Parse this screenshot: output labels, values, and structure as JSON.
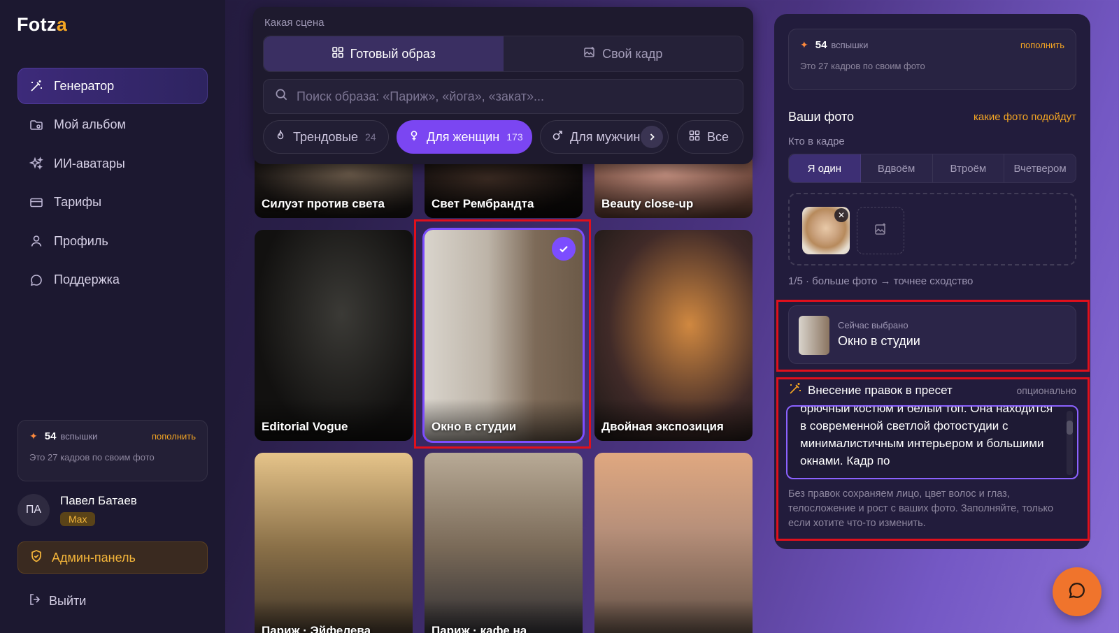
{
  "app": {
    "logo_prefix": "Fotz",
    "logo_accent": "a"
  },
  "sidebar": {
    "items": [
      {
        "label": "Генератор",
        "icon": "magic-wand-icon",
        "active": true
      },
      {
        "label": "Мой альбом",
        "icon": "folder-icon"
      },
      {
        "label": "ИИ-аватары",
        "icon": "sparkles-icon"
      },
      {
        "label": "Тарифы",
        "icon": "credit-card-icon"
      },
      {
        "label": "Профиль",
        "icon": "user-icon"
      },
      {
        "label": "Поддержка",
        "icon": "chat-icon"
      }
    ],
    "credits": {
      "count": "54",
      "unit": "вспышки",
      "topup": "пополнить",
      "sub": "Это 27 кадров по своим фото"
    },
    "user": {
      "initials": "ПА",
      "name": "Павел Батаев",
      "plan": "Max"
    },
    "admin_label": "Админ-панель",
    "logout_label": "Выйти"
  },
  "scene": {
    "label": "Какая сцена",
    "tabs": [
      {
        "label": "Готовый образ",
        "active": true
      },
      {
        "label": "Свой кадр"
      }
    ],
    "search_placeholder": "Поиск образа: «Париж», «йога», «закат»...",
    "chips": [
      {
        "label": "Трендовые",
        "count": "24"
      },
      {
        "label": "Для женщин",
        "count": "173",
        "active": true
      },
      {
        "label": "Для мужчин"
      },
      {
        "label": "Все"
      }
    ]
  },
  "gallery": {
    "tiles": [
      {
        "caption": "Силуэт против света"
      },
      {
        "caption": "Свет Рембрандта"
      },
      {
        "caption": "Beauty close-up"
      },
      {
        "caption": "Editorial Vogue"
      },
      {
        "caption": "Окно в студии",
        "selected": true
      },
      {
        "caption": "Двойная экспозиция"
      },
      {
        "caption": "Париж · Эйфелева"
      },
      {
        "caption": "Париж · кафе на"
      },
      {
        "caption": ""
      }
    ]
  },
  "panel": {
    "credits": {
      "count": "54",
      "unit": "вспышки",
      "topup": "пополнить",
      "sub": "Это 27 кадров по своим фото"
    },
    "photos_title": "Ваши фото",
    "photos_link": "какие фото подойдут",
    "who_label": "Кто в кадре",
    "who_options": [
      "Я один",
      "Вдвоём",
      "Втроём",
      "Вчетвером"
    ],
    "upload_hint": "1/5 · больше фото → точнее сходство",
    "current_label": "Сейчас выбрано",
    "current_value": "Окно в студии",
    "edit_title": "Внесение правок в пресет",
    "edit_optional": "опционально",
    "edit_text": "брючный костюм и белый топ. Она находится в современной светлой фотостудии с минималистичным интерьером и большими окнами. Кадр по",
    "edit_help": "Без правок сохраняем лицо, цвет волос и глаз, телосложение и рост с ваших фото. Заполняйте, только если хотите что-то изменить."
  },
  "colors": {
    "accent": "#7b46f2",
    "orange": "#f5a623",
    "highlight": "#e0101c"
  }
}
